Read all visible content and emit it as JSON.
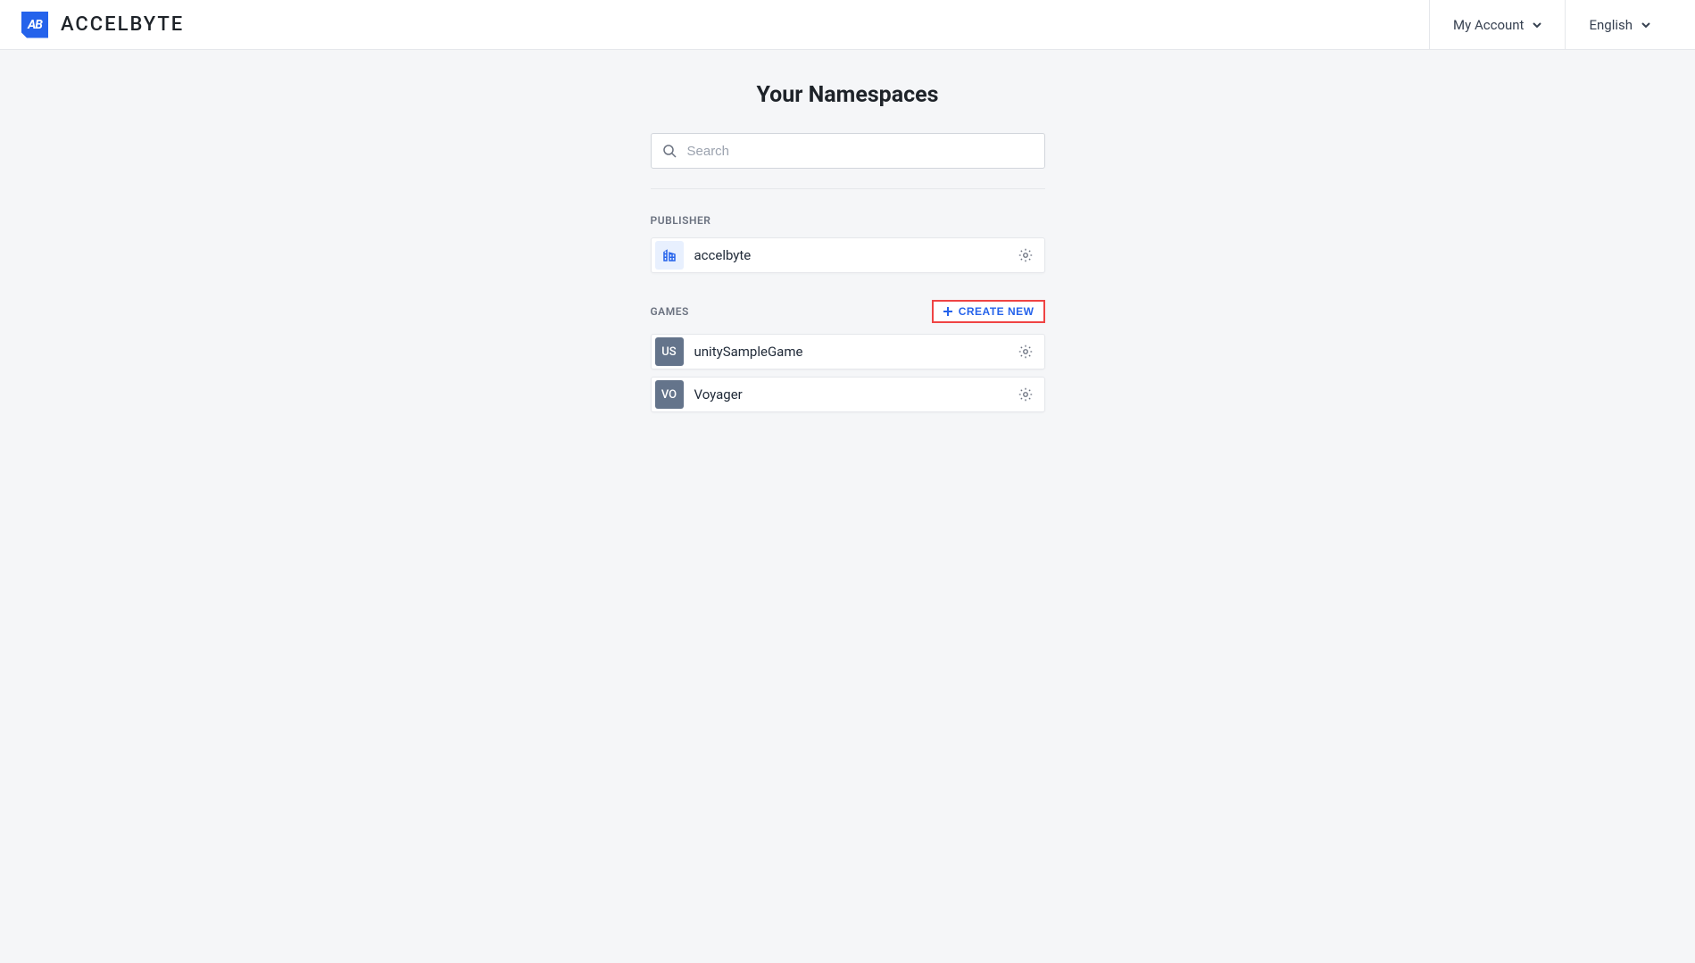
{
  "header": {
    "brand_mark": "AB",
    "brand_text": "ACCELBYTE",
    "my_account_label": "My Account",
    "language_label": "English"
  },
  "page": {
    "title": "Your Namespaces",
    "search_placeholder": "Search"
  },
  "sections": {
    "publisher": {
      "label": "PUBLISHER",
      "items": [
        {
          "name": "accelbyte",
          "icon": "building"
        }
      ]
    },
    "games": {
      "label": "GAMES",
      "create_label": "CREATE NEW",
      "items": [
        {
          "name": "unitySampleGame",
          "abbr": "US"
        },
        {
          "name": "Voyager",
          "abbr": "VO"
        }
      ]
    }
  }
}
